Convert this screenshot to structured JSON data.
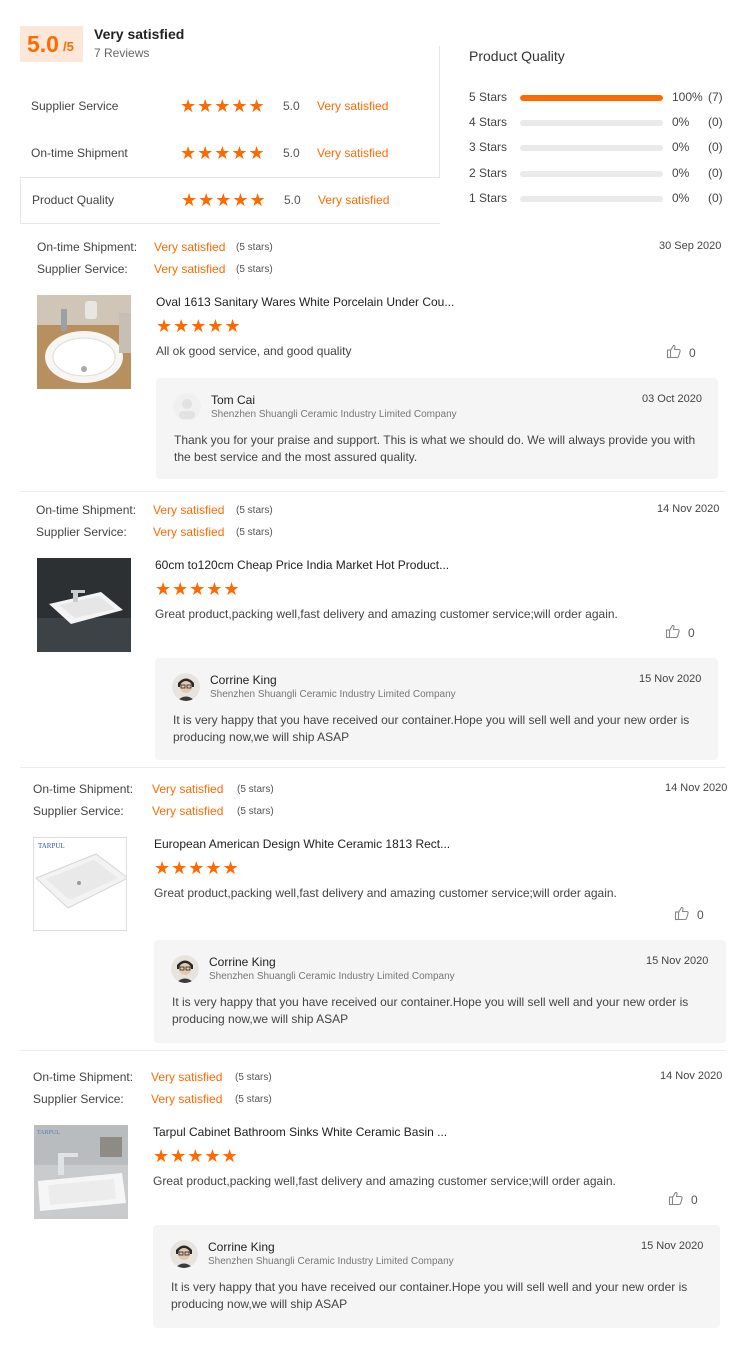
{
  "summary": {
    "score": "5.0",
    "score_max": "/5",
    "title": "Very satisfied",
    "review_count": "7 Reviews"
  },
  "ratings": [
    {
      "label": "Supplier Service",
      "score": "5.0",
      "text": "Very satisfied",
      "stars": 5
    },
    {
      "label": "On-time Shipment",
      "score": "5.0",
      "text": "Very satisfied",
      "stars": 5
    },
    {
      "label": "Product Quality",
      "score": "5.0",
      "text": "Very satisfied",
      "stars": 5
    }
  ],
  "distribution": {
    "title": "Product Quality",
    "rows": [
      {
        "label": "5 Stars",
        "pct": "100%",
        "count": "(7)",
        "fill": 1.0
      },
      {
        "label": "4 Stars",
        "pct": "0%",
        "count": "(0)",
        "fill": 0
      },
      {
        "label": "3 Stars",
        "pct": "0%",
        "count": "(0)",
        "fill": 0
      },
      {
        "label": "2 Stars",
        "pct": "0%",
        "count": "(0)",
        "fill": 0
      },
      {
        "label": "1 Stars",
        "pct": "0%",
        "count": "(0)",
        "fill": 0
      }
    ]
  },
  "colors": {
    "accent": "#ff6a00",
    "accent_light": "#fde7d8",
    "reply_bg": "#f5f5f5"
  },
  "reviews": [
    {
      "shipment_label": "On-time Shipment:",
      "shipment_value": "Very satisfied",
      "shipment_stars": "(5 stars)",
      "service_label": "Supplier Service:",
      "service_value": "Very satisfied",
      "service_stars": "(5 stars)",
      "date": "30 Sep 2020",
      "product_title": "Oval 1613 Sanitary Wares White Porcelain Under Cou...",
      "rating": 5,
      "comment": "All ok good service, and good quality",
      "likes": "0",
      "reply": {
        "name": "Tom Cai",
        "company": "Shenzhen Shuangli Ceramic Industry Limited Company",
        "date": "03 Oct 2020",
        "text": "Thank you for your praise and support. This is what we should do. We will always provide you with the best service and the most assured quality."
      }
    },
    {
      "shipment_label": "On-time Shipment:",
      "shipment_value": "Very satisfied",
      "shipment_stars": "(5 stars)",
      "service_label": "Supplier Service:",
      "service_value": "Very satisfied",
      "service_stars": "(5 stars)",
      "date": "14 Nov 2020",
      "product_title": "60cm to120cm Cheap Price India Market Hot Product...",
      "rating": 5,
      "comment": "Great product,packing well,fast delivery and amazing customer service;will order again.",
      "likes": "0",
      "reply": {
        "name": "Corrine King",
        "company": "Shenzhen Shuangli Ceramic Industry Limited Company",
        "date": "15 Nov 2020",
        "text": "It is very happy that you have received our container.Hope you will sell well and your new order is producing now,we will ship ASAP"
      }
    },
    {
      "shipment_label": "On-time Shipment:",
      "shipment_value": "Very satisfied",
      "shipment_stars": "(5 stars)",
      "service_label": "Supplier Service:",
      "service_value": "Very satisfied",
      "service_stars": "(5 stars)",
      "date": "14 Nov 2020",
      "product_title": "European American Design White Ceramic 1813 Rect...",
      "product_brand": "TARPUL",
      "rating": 5,
      "comment": "Great product,packing well,fast delivery and amazing customer service;will order again.",
      "likes": "0",
      "reply": {
        "name": "Corrine King",
        "company": "Shenzhen Shuangli Ceramic Industry Limited Company",
        "date": "15 Nov 2020",
        "text": "It is very happy that you have received our container.Hope you will sell well and your new order is producing now,we will ship ASAP"
      }
    },
    {
      "shipment_label": "On-time Shipment:",
      "shipment_value": "Very satisfied",
      "shipment_stars": "(5 stars)",
      "service_label": "Supplier Service:",
      "service_value": "Very satisfied",
      "service_stars": "(5 stars)",
      "date": "14 Nov 2020",
      "product_title": "Tarpul Cabinet Bathroom Sinks White Ceramic Basin ...",
      "product_brand": "TARPUL",
      "rating": 5,
      "comment": "Great product,packing well,fast delivery and amazing customer service;will order again.",
      "likes": "0",
      "reply": {
        "name": "Corrine King",
        "company": "Shenzhen Shuangli Ceramic Industry Limited Company",
        "date": "15 Nov 2020",
        "text": "It is very happy that you have received our container.Hope you will sell well and your new order is producing now,we will ship ASAP"
      }
    }
  ]
}
